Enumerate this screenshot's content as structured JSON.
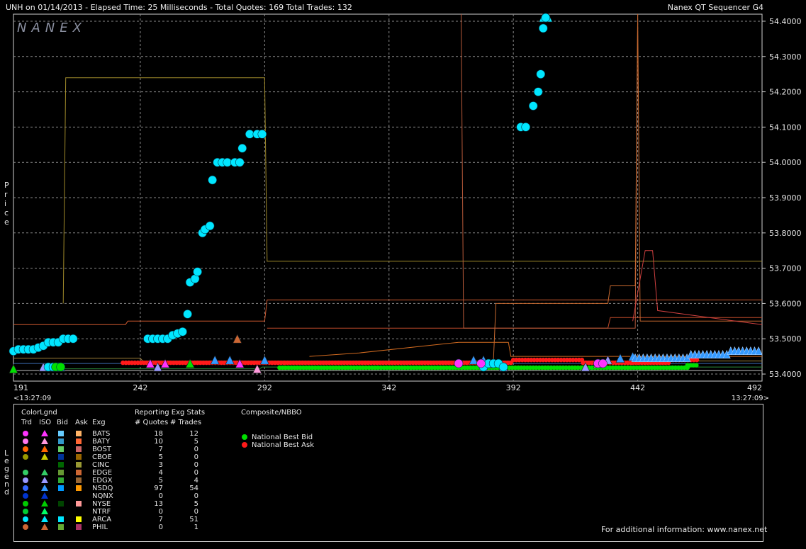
{
  "header": {
    "left": "UNH on 01/14/2013  -  Elapsed Time: 25 Milliseconds  -  Total Quotes: 169  Total Trades: 132",
    "right": "Nanex QT Sequencer G4"
  },
  "watermark": "NANEX",
  "y_axis_title": "Price",
  "legend_side_title": "Legend",
  "chart_data": {
    "type": "scatter",
    "title": "",
    "xlabel": "",
    "ylabel": "Price",
    "xlim": [
      191,
      492
    ],
    "ylim": [
      53.38,
      54.42
    ],
    "grid": true,
    "x_ticks": [
      "191",
      "242",
      "292",
      "342",
      "392",
      "442",
      "492"
    ],
    "x_tick_values": [
      191,
      242,
      292,
      342,
      392,
      442,
      492
    ],
    "y_ticks": [
      "53.4000",
      "53.5000",
      "53.6000",
      "53.7000",
      "53.8000",
      "53.9000",
      "54.0000",
      "54.1000",
      "54.2000",
      "54.3000",
      "54.4000"
    ],
    "y_tick_values": [
      53.4,
      53.5,
      53.6,
      53.7,
      53.8,
      53.9,
      54.0,
      54.1,
      54.2,
      54.3,
      54.4
    ],
    "x_start_time": "<13:27:09",
    "x_end_time": "13:27:09>",
    "series": [
      {
        "name": "NSDQ Trades",
        "marker": "circle",
        "color": "#00e6ff",
        "x": [
          191,
          193,
          195,
          197,
          199,
          201,
          203,
          205,
          207,
          209,
          211,
          213,
          215,
          245,
          247,
          249,
          251,
          253,
          255,
          257,
          259,
          261,
          262,
          264,
          265,
          267,
          268,
          270,
          271,
          273,
          275,
          277,
          280,
          282,
          283,
          286,
          289,
          291,
          395,
          397,
          400,
          402,
          403,
          404,
          405
        ],
        "y": [
          53.465,
          53.47,
          53.47,
          53.47,
          53.47,
          53.475,
          53.48,
          53.49,
          53.49,
          53.49,
          53.5,
          53.5,
          53.5,
          53.5,
          53.5,
          53.5,
          53.5,
          53.5,
          53.51,
          53.515,
          53.52,
          53.57,
          53.66,
          53.67,
          53.69,
          53.8,
          53.81,
          53.82,
          53.95,
          54.0,
          54.0,
          54.0,
          54.0,
          54.0,
          54.04,
          54.08,
          54.08,
          54.08,
          54.1,
          54.1,
          54.16,
          54.2,
          54.25,
          54.38,
          54.41
        ]
      },
      {
        "name": "Trade Low Prints",
        "marker": "circle",
        "color": "#00e6ff",
        "x": [
          205,
          207,
          209,
          380,
          382,
          384,
          386,
          388
        ],
        "y": [
          53.42,
          53.42,
          53.42,
          53.42,
          53.43,
          53.43,
          53.43,
          53.42
        ]
      },
      {
        "name": "NYSE Trades",
        "marker": "circle",
        "color": "#00e000",
        "x": [
          208,
          210
        ],
        "y": [
          53.42,
          53.42
        ]
      },
      {
        "name": "BATS Trades",
        "marker": "circle",
        "color": "#ff33ff",
        "x": [
          370,
          379,
          426,
          428
        ],
        "y": [
          53.43,
          53.43,
          53.43,
          53.43
        ]
      },
      {
        "name": "National Best Bid",
        "color": "#00e000",
        "x": [
          298,
          420,
          438,
          462,
          466
        ],
        "y": [
          53.418,
          53.418,
          53.418,
          53.425,
          53.43
        ]
      },
      {
        "name": "National Best Ask",
        "color": "#ff1a1a",
        "x": [
          235,
          300,
          385,
          392,
          420,
          440,
          455,
          466
        ],
        "y": [
          53.432,
          53.432,
          53.432,
          53.44,
          53.432,
          53.432,
          53.44,
          53.445
        ]
      }
    ]
  },
  "legend": {
    "colorlgnd_title": "ColorLgnd",
    "reporting_title": "Reporting Exg Stats",
    "composite_title": "Composite/NBBO",
    "col_trd": "Trd",
    "col_iso": "ISO",
    "col_bid": "Bid",
    "col_ask": "Ask",
    "col_exg": "Exg",
    "col_quotes": "# Quotes",
    "col_trades": "# Trades",
    "rows": [
      {
        "exg": "BATS",
        "quotes": "18",
        "trades": "12",
        "trd": "#ff33ff",
        "iso": "#ff33ff",
        "bid": "#66ccff",
        "ask": "#ffb366"
      },
      {
        "exg": "BATY",
        "quotes": "10",
        "trades": "5",
        "trd": "#ff77ee",
        "iso": "#ff99dd",
        "bid": "#3399cc",
        "ask": "#ff6633"
      },
      {
        "exg": "BOST",
        "quotes": "7",
        "trades": "0",
        "trd": "#ff6600",
        "iso": "#ff6600",
        "bid": "#66cc66",
        "ask": "#cc6666"
      },
      {
        "exg": "CBOE",
        "quotes": "5",
        "trades": "0",
        "trd": "#999900",
        "iso": "#cccc00",
        "bid": "#003399",
        "ask": "#996600"
      },
      {
        "exg": "CINC",
        "quotes": "3",
        "trades": "0",
        "trd": "",
        "iso": "",
        "bid": "#006600",
        "ask": "#999933"
      },
      {
        "exg": "EDGE",
        "quotes": "4",
        "trades": "0",
        "trd": "#33cc66",
        "iso": "#33cc66",
        "bid": "#669933",
        "ask": "#cc6633"
      },
      {
        "exg": "EDGX",
        "quotes": "5",
        "trades": "4",
        "trd": "#9999ff",
        "iso": "#9999ff",
        "bid": "#33aa33",
        "ask": "#996633"
      },
      {
        "exg": "NSDQ",
        "quotes": "97",
        "trades": "54",
        "trd": "#3366ff",
        "iso": "#3399ff",
        "bid": "#0099ff",
        "ask": "#ff9900"
      },
      {
        "exg": "NQNX",
        "quotes": "0",
        "trades": "0",
        "trd": "#0033cc",
        "iso": "#0033cc",
        "bid": "",
        "ask": ""
      },
      {
        "exg": "NYSE",
        "quotes": "13",
        "trades": "5",
        "trd": "#00cc00",
        "iso": "#00cc00",
        "bid": "#004400",
        "ask": "#ff9999"
      },
      {
        "exg": "NTRF",
        "quotes": "0",
        "trades": "0",
        "trd": "#00cc33",
        "iso": "#00ff66",
        "bid": "",
        "ask": ""
      },
      {
        "exg": "ARCA",
        "quotes": "7",
        "trades": "51",
        "trd": "#00e6ff",
        "iso": "#00e6ff",
        "bid": "#00e6ff",
        "ask": "#ffff00"
      },
      {
        "exg": "PHIL",
        "quotes": "0",
        "trades": "1",
        "trd": "#cc6633",
        "iso": "#cc6633",
        "bid": "#66aa33",
        "ask": "#aa3366"
      }
    ],
    "composite": [
      {
        "label": "National Best Bid",
        "color": "#00e000"
      },
      {
        "label": "National Best Ask",
        "color": "#ff1a1a"
      }
    ],
    "footer": "For additional information: www.nanex.net"
  }
}
